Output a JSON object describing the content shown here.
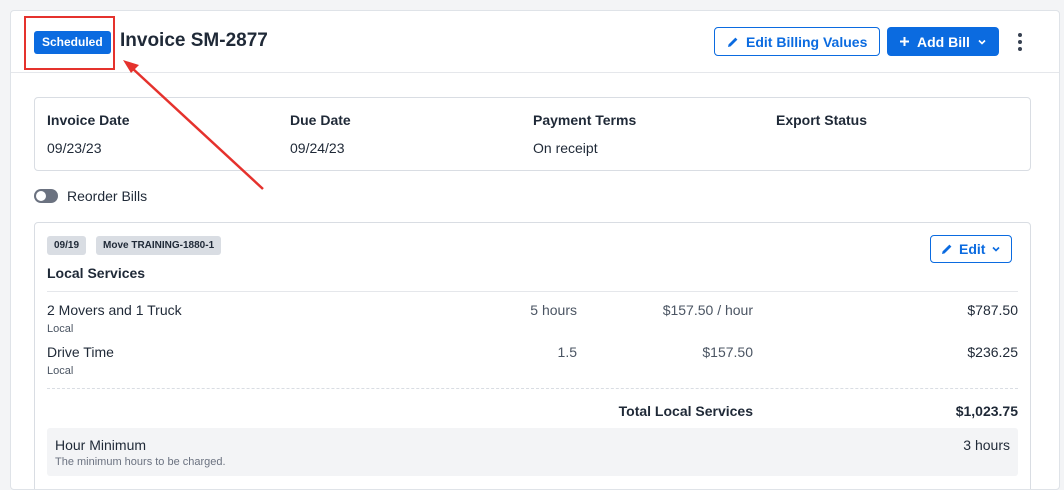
{
  "header": {
    "status": "Scheduled",
    "title": "Invoice SM-2877",
    "edit_billing_label": "Edit Billing Values",
    "add_bill_label": "Add Bill"
  },
  "info": {
    "invoice_date_label": "Invoice Date",
    "invoice_date_value": "09/23/23",
    "due_date_label": "Due Date",
    "due_date_value": "09/24/23",
    "payment_terms_label": "Payment Terms",
    "payment_terms_value": "On receipt",
    "export_status_label": "Export Status"
  },
  "reorder_label": "Reorder Bills",
  "bill": {
    "tag_date": "09/19",
    "tag_move": "Move TRAINING-1880-1",
    "edit_label": "Edit",
    "title": "Local Services",
    "items": [
      {
        "name": "2 Movers and 1 Truck",
        "sub": "Local",
        "qty": "5 hours",
        "rate": "$157.50 / hour",
        "total": "$787.50"
      },
      {
        "name": "Drive Time",
        "sub": "Local",
        "qty": "1.5",
        "rate": "$157.50",
        "total": "$236.25"
      }
    ],
    "total_label": "Total Local Services",
    "total_value": "$1,023.75",
    "minimum": {
      "title": "Hour Minimum",
      "desc": "The minimum hours to be charged.",
      "value": "3 hours"
    }
  },
  "colors": {
    "accent": "#0b6be0",
    "annotation": "#e5322d"
  }
}
